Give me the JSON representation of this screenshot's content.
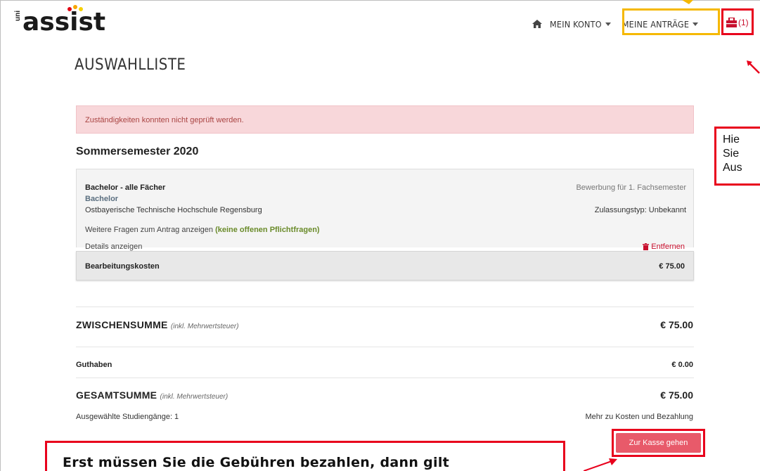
{
  "header": {
    "logo": {
      "prefix": "uni",
      "name": "assist"
    },
    "nav": {
      "home_icon": "home-icon",
      "account": "MEIN KONTO",
      "applications": "MEINE ANTRÄGE",
      "cart_count": "(1)",
      "cart_icon": "cart-icon"
    }
  },
  "page": {
    "title": "AUSWAHLLISTE",
    "alert": "Zuständigkeiten konnten nicht geprüft werden.",
    "semester": "Sommersemester 2020"
  },
  "application": {
    "name": "Bachelor - alle Fächer",
    "degree": "Bachelor",
    "university": "Ostbayerische Technische Hochschule Regensburg",
    "apply_type": "Bewerbung für 1. Fachsemester",
    "admission": "Zulassungstyp: Unbekannt",
    "questions_text": "Weitere Fragen zum Antrag anzeigen",
    "questions_status": "(keine offenen Pflichtfragen)",
    "details": "Details anzeigen",
    "remove": "Entfernen",
    "fee_label": "Bearbeitungskosten",
    "fee_value": "€ 75.00"
  },
  "totals": {
    "subtotal_label": "ZWISCHENSUMME",
    "subtotal_note": "(inkl. Mehrwertsteuer)",
    "subtotal_value": "€ 75.00",
    "credit_label": "Guthaben",
    "credit_value": "€ 0.00",
    "total_label": "GESAMTSUMME",
    "total_note": "(inkl. Mehrwertsteuer)",
    "total_value": "€ 75.00",
    "selected": "Ausgewählte Studiengänge: 1",
    "more_link": "Mehr zu Kosten und Bezahlung",
    "checkout": "Zur Kasse gehen"
  },
  "annotations": {
    "right_callout": [
      "Hie",
      "Sie",
      "Aus"
    ],
    "bottom_callout": "Erst müssen Sie die Gebühren bezahlen, dann gilt"
  },
  "colors": {
    "accent_red": "#e8001c",
    "highlight_yellow": "#f5b800",
    "button_red": "#e85a6a",
    "alert_bg": "#f8d7da"
  }
}
